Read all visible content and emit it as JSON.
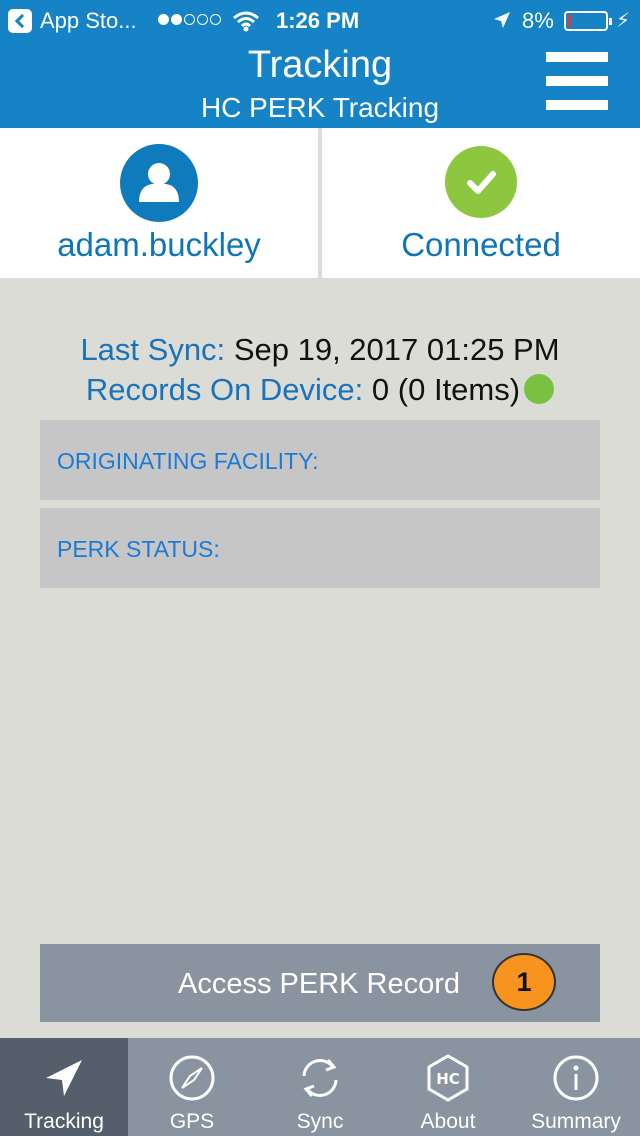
{
  "status_bar": {
    "back_label": "App Sto...",
    "time": "1:26 PM",
    "battery_pct": "8%",
    "battery_level": 0.08
  },
  "header": {
    "title": "Tracking",
    "subtitle": "HC PERK Tracking"
  },
  "user_panel": {
    "username": "adam.buckley"
  },
  "connection_panel": {
    "status": "Connected"
  },
  "sync_info": {
    "last_sync_label": "Last Sync:",
    "last_sync_value": "Sep 19, 2017 01:25 PM",
    "records_label": "Records On Device:",
    "records_value": "0 (0 Items)",
    "records_status_color": "#7ac142"
  },
  "fields": {
    "originating_facility_label": "ORIGINATING FACILITY:",
    "perk_status_label": "PERK STATUS:"
  },
  "access_button": {
    "label": "Access PERK Record",
    "badge_count": "1"
  },
  "tabs": [
    {
      "label": "Tracking",
      "icon": "navigation-arrow-icon",
      "active": true
    },
    {
      "label": "GPS",
      "icon": "compass-icon",
      "active": false
    },
    {
      "label": "Sync",
      "icon": "sync-icon",
      "active": false
    },
    {
      "label": "About",
      "icon": "hc-logo-icon",
      "active": false
    },
    {
      "label": "Summary",
      "icon": "info-icon",
      "active": false
    }
  ],
  "colors": {
    "header_bg": "#1683c6",
    "accent_text": "#0e76b6",
    "tab_bar_bg": "#8a93a0",
    "tab_active_bg": "#555f6b",
    "badge_bg": "#f7931e"
  }
}
